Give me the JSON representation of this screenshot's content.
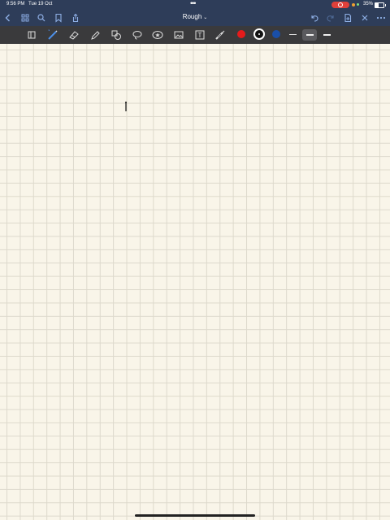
{
  "status_bar": {
    "time": "9:56 PM",
    "date": "Tue 19 Oct",
    "more_dots": "•••",
    "battery_percent": "35%",
    "battery_level": 0.35,
    "recording": true
  },
  "nav_bar": {
    "title": "Rough",
    "title_caret": "⌄",
    "left_icons": [
      "back-icon",
      "grid-icon",
      "search-icon",
      "bookmark-icon",
      "share-icon"
    ],
    "right_icons": [
      "undo-icon",
      "redo-icon",
      "add-page-icon",
      "close-icon",
      "more-icon"
    ]
  },
  "toolbar": {
    "tools": [
      "scan-icon",
      "pen-icon",
      "eraser-icon",
      "highlighter-icon",
      "shapes-icon",
      "lasso-icon",
      "elements-icon",
      "image-icon",
      "text-icon",
      "laser-icon"
    ],
    "text_tool_label": "T",
    "selected_tool": "pen",
    "colors": [
      "#e51b1b",
      "#111111",
      "#1a4fa8"
    ],
    "selected_color": "#111111",
    "stroke_widths": [
      "thin",
      "medium",
      "thick"
    ],
    "selected_stroke": "medium"
  },
  "canvas": {
    "paper": "grid",
    "background_color": "#f9f5e9"
  }
}
